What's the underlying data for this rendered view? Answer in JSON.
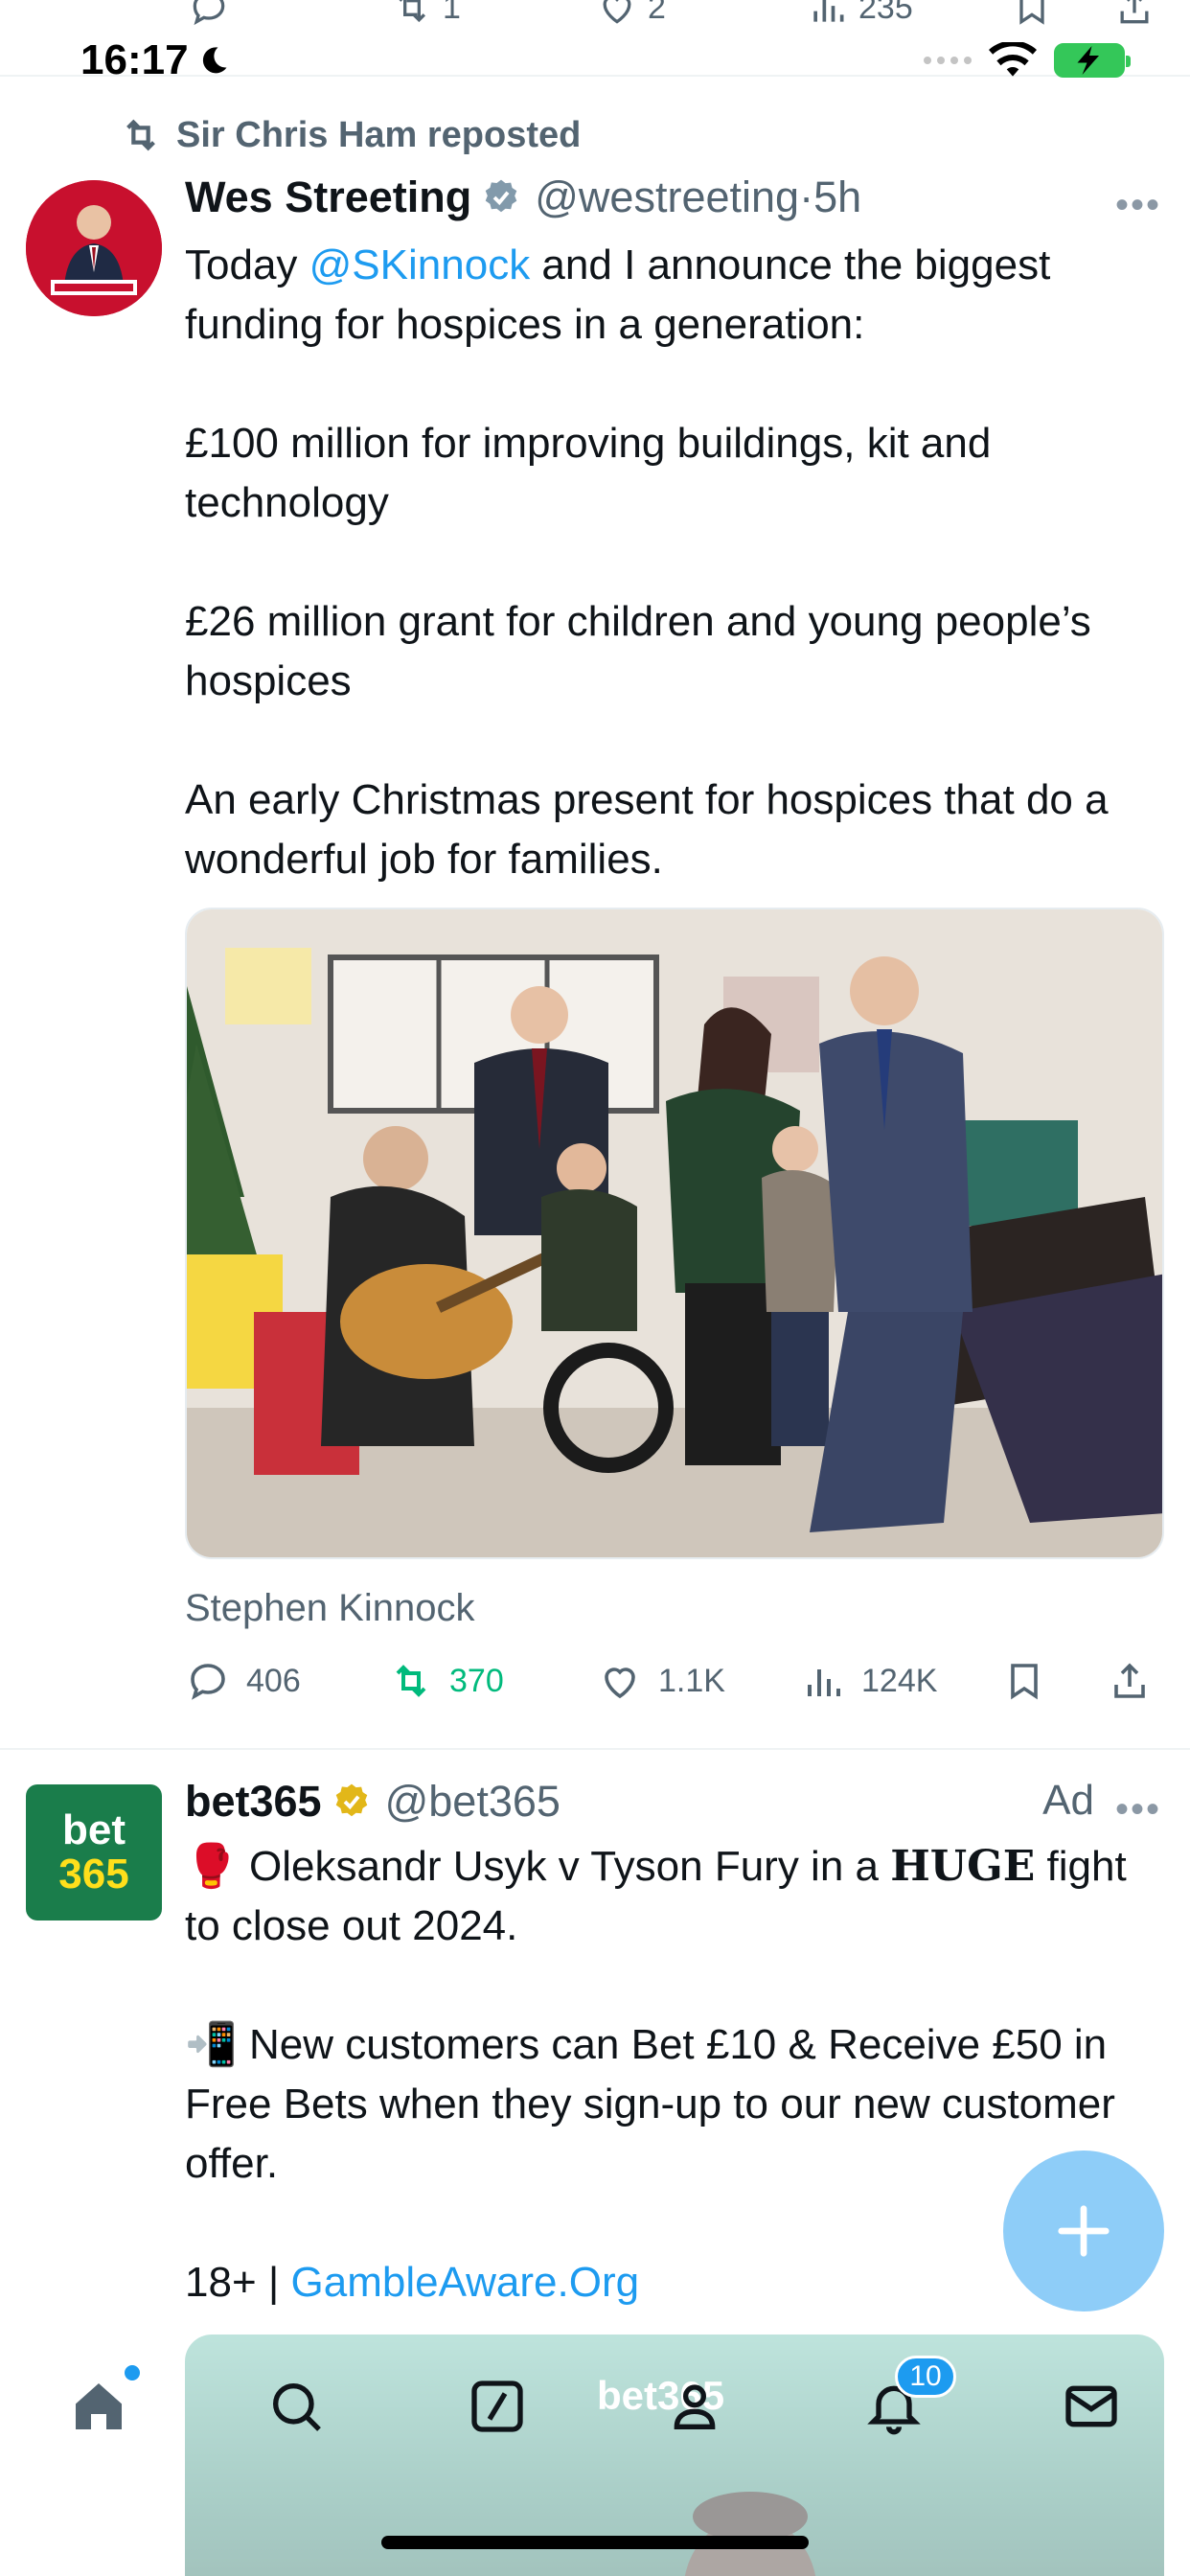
{
  "status_bar": {
    "time": "16:17"
  },
  "prev_tweet_actions": {
    "reposts": "1",
    "likes": "2",
    "views": "235"
  },
  "tweet": {
    "repost_by": "Sir Chris Ham reposted",
    "author_name": "Wes Streeting",
    "handle": "@westreeting",
    "time": "5h",
    "body_lines": [
      [
        "Today ",
        "@SKinnock",
        " and I announce the biggest funding for hospices in a generation:"
      ],
      "£100 million for improving buildings, kit and technology",
      "£26 million grant for children and young people’s hospices",
      "An early Christmas present for hospices that do a wonderful job for families."
    ],
    "body": {
      "intro_before": "Today ",
      "mention": "@SKinnock",
      "intro_after": " and I announce the biggest funding for hospices in a generation:",
      "line2": "£100 million for improving buildings, kit and technology",
      "line3": "£26 million grant for children and young people’s hospices",
      "line4": "An early Christmas present for hospices that do a wonderful job for families."
    },
    "photo_alt": "Group photo in a hospice playroom",
    "caption": "Stephen Kinnock",
    "replies": "406",
    "reposts": "370",
    "likes": "1.1K",
    "views": "124K"
  },
  "ad": {
    "author_name": "bet365",
    "handle": "@bet365",
    "label": "Ad",
    "logo_top": "bet",
    "logo_bottom": "365",
    "line1_emoji": "🥊",
    "line1_text": " Oleksandr Usyk v Tyson Fury in a ",
    "line1_huge": "HUGE",
    "line1_end": " fight to close out 2024.",
    "line2_emoji": "📲",
    "line2_text": " New customers can Bet £10 & Receive £50 in Free Bets when they sign-up to our new customer offer.",
    "line3_prefix": "18+ | ",
    "line3_link": "GambleAware.Org",
    "media_brand": "bet365"
  },
  "tabbar": {
    "notifications_badge": "10"
  },
  "colors": {
    "accent": "#1d9bf0",
    "repost_green": "#00ba7c",
    "muted": "#536471",
    "brand_green": "#1a7d4b",
    "brand_yellow": "#ffdf1b"
  }
}
